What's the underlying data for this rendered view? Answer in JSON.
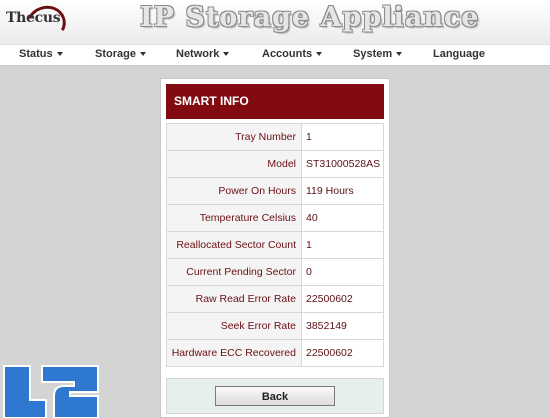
{
  "header": {
    "logo_text": "Thecus",
    "title": "IP Storage Appliance"
  },
  "nav": {
    "items": [
      {
        "label": "Status",
        "has_menu": true
      },
      {
        "label": "Storage",
        "has_menu": true
      },
      {
        "label": "Network",
        "has_menu": true
      },
      {
        "label": "Accounts",
        "has_menu": true
      },
      {
        "label": "System",
        "has_menu": true
      },
      {
        "label": "Language",
        "has_menu": false
      }
    ]
  },
  "panel": {
    "title": "SMART INFO",
    "rows": [
      {
        "label": "Tray Number",
        "value": "1"
      },
      {
        "label": "Model",
        "value": "ST31000528AS"
      },
      {
        "label": "Power On Hours",
        "value": "119 Hours"
      },
      {
        "label": "Temperature Celsius",
        "value": "40"
      },
      {
        "label": "Reallocated Sector Count",
        "value": "1"
      },
      {
        "label": "Current Pending Sector",
        "value": "0"
      },
      {
        "label": "Raw Read Error Rate",
        "value": "22500602"
      },
      {
        "label": "Seek Error Rate",
        "value": "3852149"
      },
      {
        "label": "Hardware ECC Recovered",
        "value": "22500602"
      }
    ],
    "back_label": "Back"
  },
  "colors": {
    "accent": "#820b12",
    "label_text": "#6b1015",
    "watermark_blue": "#2f78d2"
  },
  "icons": {
    "logo": "thecus-logo-swoosh",
    "watermark": "legit-reviews-logo"
  }
}
